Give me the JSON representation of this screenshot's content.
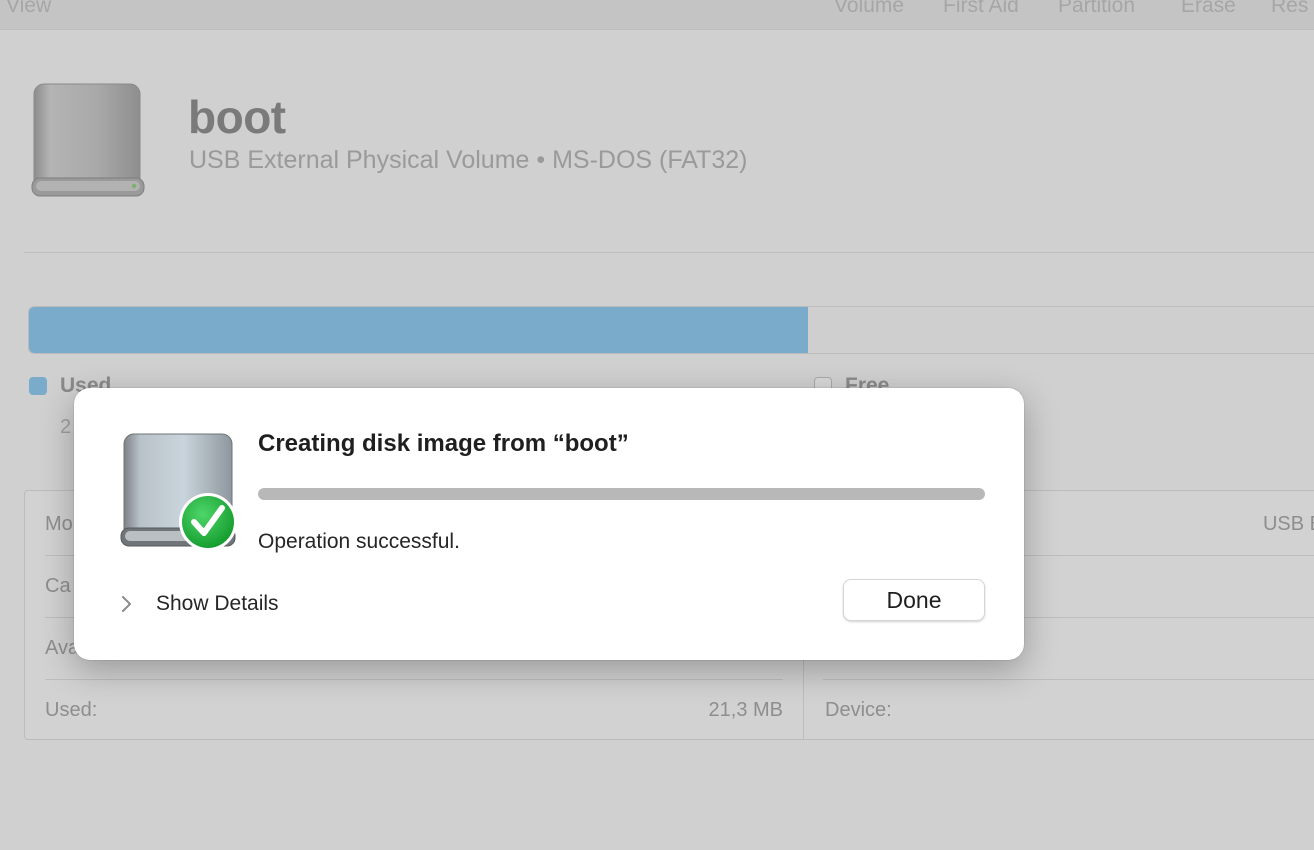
{
  "toolbar": {
    "view": "View",
    "volume": "Volume",
    "first_aid": "First Aid",
    "partition": "Partition",
    "erase": "Erase",
    "restore": "Res"
  },
  "header": {
    "volume_name": "boot",
    "subtitle": "USB External Physical Volume • MS-DOS (FAT32)"
  },
  "usage": {
    "used_fraction": 0.6,
    "used_color": "#7aabcb",
    "used_label": "Used",
    "used_value_partial": "2",
    "free_label": "Free"
  },
  "info": {
    "left": [
      {
        "label": "Mo",
        "value": ""
      },
      {
        "label": "Ca",
        "value": ""
      },
      {
        "label": "Ava",
        "value": ""
      },
      {
        "label": "Used:",
        "value": "21,3 MB"
      }
    ],
    "right": [
      {
        "label": "",
        "value": "USB E"
      },
      {
        "label": "",
        "value": ""
      },
      {
        "label": "",
        "value": ""
      },
      {
        "label": "Device:",
        "value": ""
      }
    ]
  },
  "dialog": {
    "title": "Creating disk image from “boot”",
    "progress_fraction": 1.0,
    "status": "Operation successful.",
    "show_details_label": "Show Details",
    "done_label": "Done",
    "success_color": "#1fb43a"
  }
}
